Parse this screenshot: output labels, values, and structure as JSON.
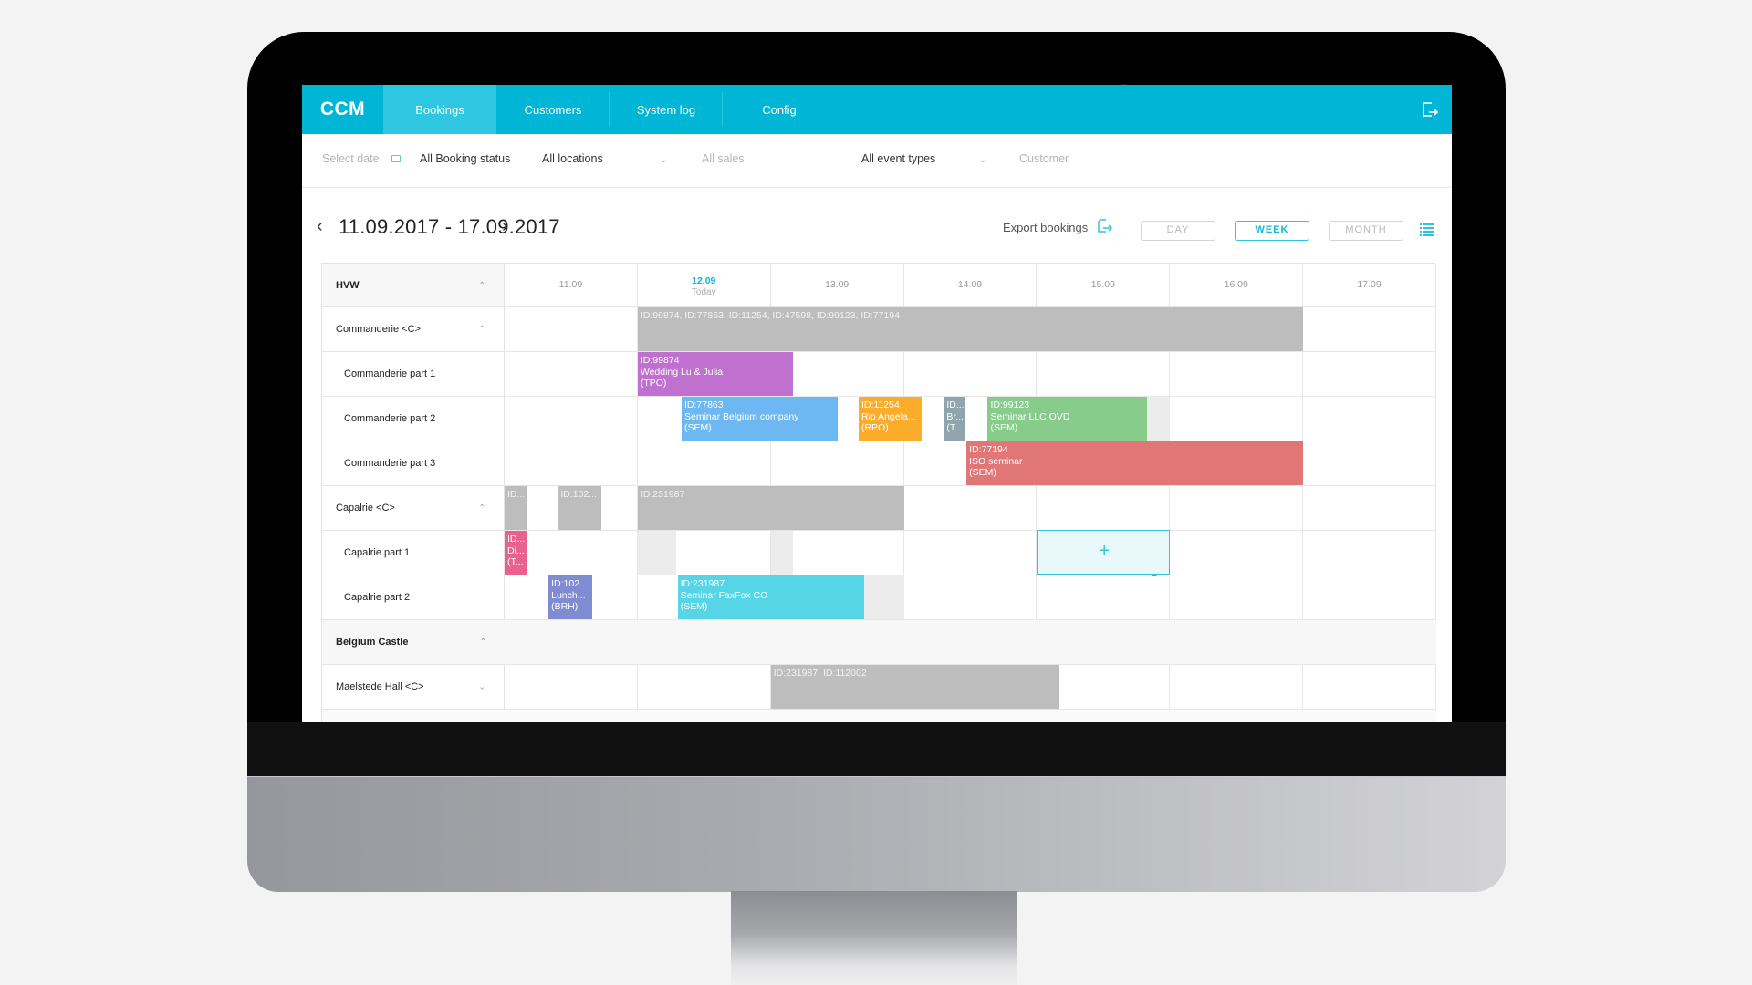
{
  "app": {
    "logo": "CCM",
    "nav": [
      {
        "label": "Bookings",
        "active": true
      },
      {
        "label": "Customers",
        "active": false
      },
      {
        "label": "System log",
        "active": false
      },
      {
        "label": "Config",
        "active": false
      }
    ],
    "logout_icon": "logout-icon",
    "accent_color": "#00b5d5"
  },
  "filters": {
    "date": {
      "placeholder": "Select date",
      "icon": "calendar-icon"
    },
    "booking_status": {
      "value": "All Booking status"
    },
    "locations": {
      "value": "All locations"
    },
    "sales": {
      "placeholder": "All sales"
    },
    "event_types": {
      "value": "All event types"
    },
    "customer": {
      "placeholder": "Customer"
    }
  },
  "toolbar": {
    "date_range": "11.09.2017 - 17.09.2017",
    "prev_icon": "chevron-left-icon",
    "next_icon": "chevron-right-icon",
    "export_label": "Export bookings",
    "views": [
      {
        "label": "DAY",
        "active": false
      },
      {
        "label": "WEEK",
        "active": true
      },
      {
        "label": "MONTH",
        "active": false
      }
    ],
    "list_icon": "list-view-icon"
  },
  "calendar": {
    "group_header": "HVW",
    "days": [
      {
        "label": "11.09",
        "today": false
      },
      {
        "label": "12.09",
        "today": true,
        "sub": "Today"
      },
      {
        "label": "13.09",
        "today": false
      },
      {
        "label": "14.09",
        "today": false
      },
      {
        "label": "15.09",
        "today": false
      },
      {
        "label": "16.09",
        "today": false
      },
      {
        "label": "17.09",
        "today": false
      }
    ],
    "rows": [
      {
        "label": "Commanderie <C>",
        "type": "parent",
        "expanded": true,
        "bookings": [
          {
            "lines": [
              "ID:99874, ID:77863, ID:11254, ID:47598, ID:99123, ID:77194"
            ],
            "start_day": 1.0,
            "end_day": 6.0,
            "color": "#bdbdbd",
            "kind": "summary"
          }
        ]
      },
      {
        "label": "Commanderie part 1",
        "type": "child",
        "bookings": [
          {
            "lines": [
              "ID:99874",
              "Wedding Lu & Julia",
              "(TPO)"
            ],
            "start_day": 1.0,
            "end_day": 2.17,
            "color": "#c071cf"
          }
        ]
      },
      {
        "label": "Commanderie part 2",
        "type": "child",
        "bookings": [
          {
            "lines": [
              "ID:77863",
              "Seminar Belgium company",
              "(SEM)"
            ],
            "start_day": 1.33,
            "end_day": 2.5,
            "color": "#6db8f2"
          },
          {
            "lines": [
              "ID:11254",
              "Rip Angela...",
              "(RPO)"
            ],
            "start_day": 1.66,
            "end_day": 2.13,
            "color": "#fbac2a",
            "offset_day": 1.0
          },
          {
            "lines": [
              "ID...",
              "Br...",
              "(T..."
            ],
            "start_day": 3.3,
            "end_day": 3.46,
            "color": "#90a4ae"
          },
          {
            "lines": [
              "ID:99123",
              "Seminar LLC OVD",
              "(SEM)"
            ],
            "start_day": 3.63,
            "end_day": 4.83,
            "color": "#88cc8c"
          },
          {
            "lines": [],
            "start_day": 4.83,
            "end_day": 5.0,
            "kind": "unavailable"
          }
        ]
      },
      {
        "label": "Commanderie part 3",
        "type": "child",
        "bookings": [
          {
            "lines": [
              "ID:77194",
              "ISO seminar",
              "(SEM)"
            ],
            "start_day": 3.47,
            "end_day": 6.0,
            "color": "#e07675"
          }
        ]
      },
      {
        "label": "Capalrie <C>",
        "type": "parent",
        "expanded": true,
        "bookings": [
          {
            "lines": [
              "ID..."
            ],
            "start_day": 0.0,
            "end_day": 0.17,
            "color": "#bdbdbd",
            "kind": "summary"
          },
          {
            "lines": [
              "ID:102..."
            ],
            "start_day": 0.4,
            "end_day": 0.73,
            "color": "#bdbdbd",
            "kind": "summary"
          },
          {
            "lines": [
              "ID:231987"
            ],
            "start_day": 1.0,
            "end_day": 3.0,
            "color": "#bdbdbd",
            "kind": "summary"
          }
        ]
      },
      {
        "label": "Capalrie part 1",
        "type": "child",
        "new_booking_day": 4,
        "bookings": [
          {
            "lines": [
              "ID...",
              "Di...",
              "(T..."
            ],
            "start_day": 0.0,
            "end_day": 0.17,
            "color": "#e9628f"
          },
          {
            "lines": [],
            "start_day": 1.0,
            "end_day": 1.29,
            "kind": "unavailable"
          },
          {
            "lines": [],
            "start_day": 2.0,
            "end_day": 2.17,
            "kind": "unavailable"
          }
        ]
      },
      {
        "label": "Capalrie part 2",
        "type": "child",
        "bookings": [
          {
            "lines": [
              "ID:102...",
              "Lunch...",
              "(BRH)"
            ],
            "start_day": 0.33,
            "end_day": 0.66,
            "color": "#7f8cd2"
          },
          {
            "lines": [
              "ID:231987",
              "Seminar FaxFox CO",
              "(SEM)"
            ],
            "start_day": 1.3,
            "end_day": 2.7,
            "color": "#55d5e6"
          },
          {
            "lines": [],
            "start_day": 2.7,
            "end_day": 3.0,
            "kind": "unavailable"
          }
        ]
      },
      {
        "label": "Belgium Castle",
        "type": "section",
        "expanded": true,
        "bookings": []
      },
      {
        "label": "Maelstede Hall <C>",
        "type": "parent",
        "expanded": false,
        "bookings": [
          {
            "lines": [
              "ID:231987, ID:112002"
            ],
            "start_day": 2.0,
            "end_day": 4.17,
            "color": "#bdbdbd",
            "kind": "summary"
          }
        ]
      }
    ]
  }
}
